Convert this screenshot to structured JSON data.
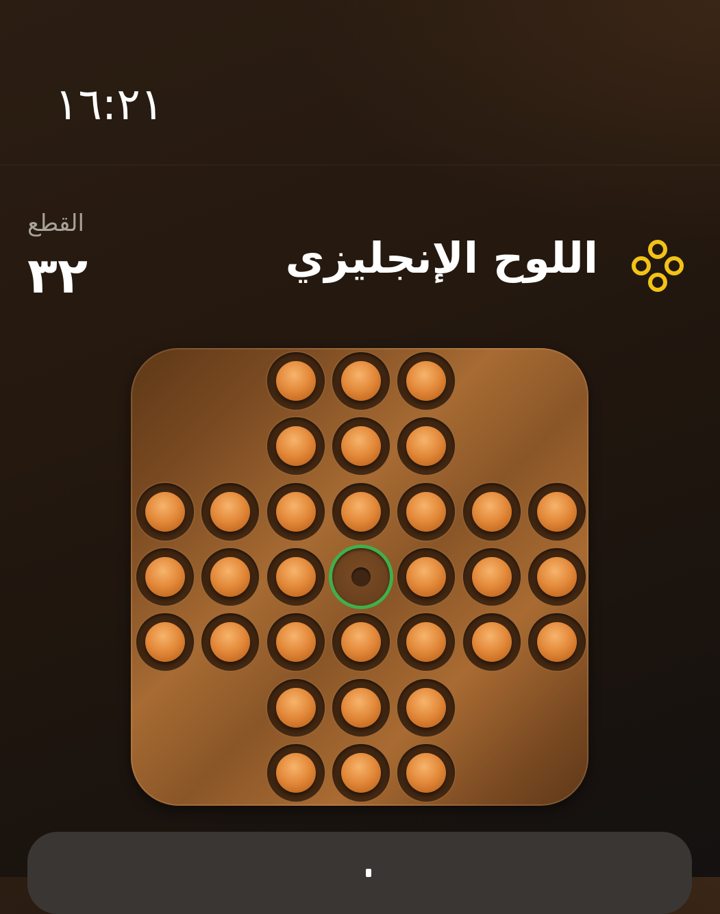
{
  "status_bar": {
    "time": "١٦:٢١"
  },
  "header": {
    "pieces_label": "القطع",
    "pieces_count": "٣٢",
    "board_title": "اللوح الإنجليزي",
    "board_icon": "four-rings-icon",
    "icon_color": "#f2c316"
  },
  "board": {
    "type": "english-peg-solitaire",
    "rows": 7,
    "cols": 7,
    "layout": [
      "..XXX..",
      "..XXX..",
      "XXXXXXX",
      "XXXOXXX",
      "XXXXXXX",
      "..XXX..",
      "..XXX.."
    ],
    "selected": [
      3,
      3
    ],
    "colors": {
      "peg": "#e48b3c",
      "selection_ring": "#3fb04a"
    }
  }
}
